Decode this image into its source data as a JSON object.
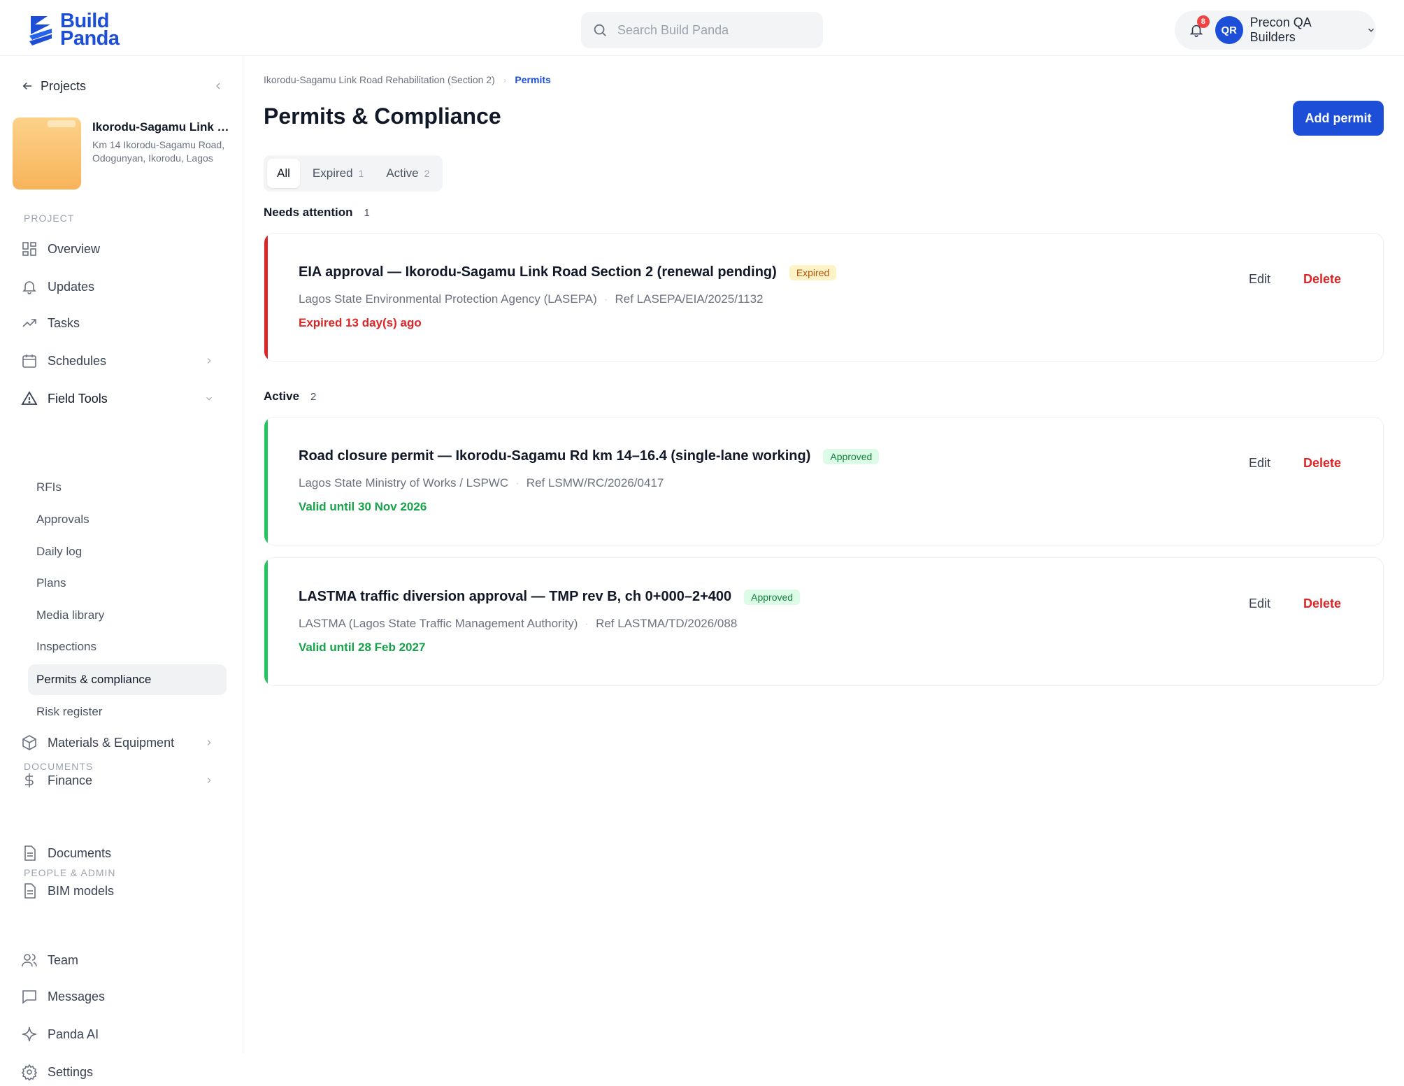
{
  "app": {
    "logo_line1": "Build",
    "logo_line2": "Panda",
    "search_placeholder": "Search Build Panda",
    "notification_count": "8",
    "avatar_initials": "QR",
    "org_name": "Precon QA Builders",
    "brand_color": "#1d4ed8"
  },
  "sidebar": {
    "back_label": "Projects",
    "project": {
      "name": "Ikorodu-Sagamu Link Road Rehabilitation (Section 2)",
      "address": "Km 14 Ikorodu-Sagamu Road, Odogunyan, Ikorodu, Lagos"
    },
    "sections": {
      "project": "PROJECT",
      "documents": "DOCUMENTS",
      "people_admin": "PEOPLE & ADMIN"
    },
    "nav": {
      "overview": "Overview",
      "updates": "Updates",
      "tasks": "Tasks",
      "schedules": "Schedules",
      "field_tools": "Field Tools",
      "materials_equipment": "Materials & Equipment",
      "finance": "Finance",
      "documents": "Documents",
      "bim_models": "BIM models",
      "team": "Team",
      "messages": "Messages",
      "panda_ai": "Panda AI",
      "settings": "Settings"
    },
    "field_tools_items": {
      "rfis": "RFIs",
      "approvals": "Approvals",
      "daily_log": "Daily log",
      "plans": "Plans",
      "media_library": "Media library",
      "inspections": "Inspections",
      "permits_compliance": "Permits & compliance",
      "risk_register": "Risk register"
    }
  },
  "main": {
    "breadcrumb": {
      "project": "Ikorodu-Sagamu Link Road Rehabilitation (Section 2)",
      "current": "Permits"
    },
    "title": "Permits & Compliance",
    "add_button": "Add permit",
    "tabs": [
      {
        "label": "All",
        "count": ""
      },
      {
        "label": "Expired",
        "count": "1"
      },
      {
        "label": "Active",
        "count": "2"
      }
    ],
    "groups": {
      "needs_attention": {
        "label": "Needs attention",
        "count": "1"
      },
      "active": {
        "label": "Active",
        "count": "2"
      }
    },
    "permits": [
      {
        "title": "EIA approval — Ikorodu-Sagamu Link Road Section 2 (renewal pending)",
        "badge": "Expired",
        "authority": "Lagos State Environmental Protection Agency (LASEPA)",
        "ref": "Ref LASEPA/EIA/2025/1132",
        "status": "Expired 13 day(s) ago",
        "status_color": "#dc2626",
        "edit": "Edit",
        "delete": "Delete"
      },
      {
        "title": "Road closure permit — Ikorodu-Sagamu Rd km 14–16.4 (single-lane working)",
        "badge": "Approved",
        "authority": "Lagos State Ministry of Works / LSPWC",
        "ref": "Ref LSMW/RC/2026/0417",
        "status": "Valid until 30 Nov 2026",
        "status_color": "#16a34a",
        "edit": "Edit",
        "delete": "Delete"
      },
      {
        "title": "LASTMA traffic diversion approval — TMP rev B, ch 0+000–2+400",
        "badge": "Approved",
        "authority": "LASTMA (Lagos State Traffic Management Authority)",
        "ref": "Ref LASTMA/TD/2026/088",
        "status": "Valid until 28 Feb 2027",
        "status_color": "#16a34a",
        "edit": "Edit",
        "delete": "Delete"
      }
    ]
  }
}
